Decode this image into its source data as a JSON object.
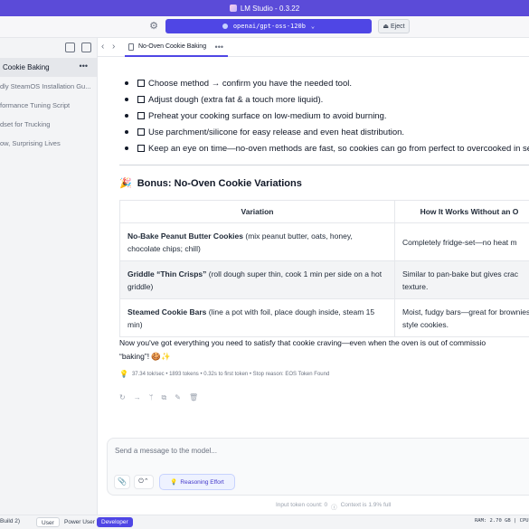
{
  "window": {
    "title": "LM Studio - 0.3.22"
  },
  "topbar": {
    "model": "openai/gpt-oss-120b",
    "eject_label": "Eject"
  },
  "sidebar": {
    "items": [
      {
        "label": "Cookie Baking",
        "active": true
      },
      {
        "label": "dly SteamOS Installation Gu..."
      },
      {
        "label": "formance Tuning Script"
      },
      {
        "label": "dset for Trucking"
      },
      {
        "label": "ow, Surprising Lives"
      }
    ]
  },
  "tabs": [
    {
      "label": "No-Oven Cookie Baking"
    }
  ],
  "message": {
    "checklist": [
      "Choose method → confirm you have the needed tool.",
      "Adjust dough (extra fat & a touch more liquid).",
      "Preheat your cooking surface on low-medium to avoid burning.",
      "Use parchment/silicone for easy release and even heat distribution.",
      "Keep an eye on time—no-oven methods are fast, so cookies can go from perfect to overcooked in se"
    ],
    "bonus_heading": "Bonus: No-Oven Cookie Variations",
    "table": {
      "headers": [
        "Variation",
        "How It Works Without an O"
      ],
      "rows": [
        {
          "name": "No-Bake Peanut Butter Cookies",
          "detail": "(mix peanut butter, oats, honey, chocolate chips; chill)",
          "how": "Completely fridge-set—no heat m"
        },
        {
          "name": "Griddle “Thin Crisps”",
          "detail": "(roll dough super thin, cook 1 min per side on a hot griddle)",
          "how": "Similar to pan-bake but gives crac texture."
        },
        {
          "name": "Steamed Cookie Bars",
          "detail": "(line a pot with foil, place dough inside, steam 15 min)",
          "how": "Moist, fudgy bars—great for brownies-style cookies."
        }
      ]
    },
    "closing_line1": "Now you've got everything you need to satisfy that cookie craving—even when the oven is out of commissio",
    "closing_line2": "“baking”! 🍪✨",
    "stats": "37.34 tok/sec • 1893 tokens • 0.32s to first token • Stop reason: EOS Token Found"
  },
  "composer": {
    "placeholder": "Send a message to the model...",
    "reasoning_label": "Reasoning Effort"
  },
  "footer": {
    "token_count": "Input token count: 0",
    "context": "Context is 1.9% full"
  },
  "statusbar": {
    "build": "Build 2)",
    "modes": [
      "User",
      "Power User",
      "Developer"
    ],
    "ram": "RAM: 2.70 GB | CPU"
  },
  "colors": {
    "accent": "#4f46e5",
    "titlebar": "#5b4bd8"
  }
}
